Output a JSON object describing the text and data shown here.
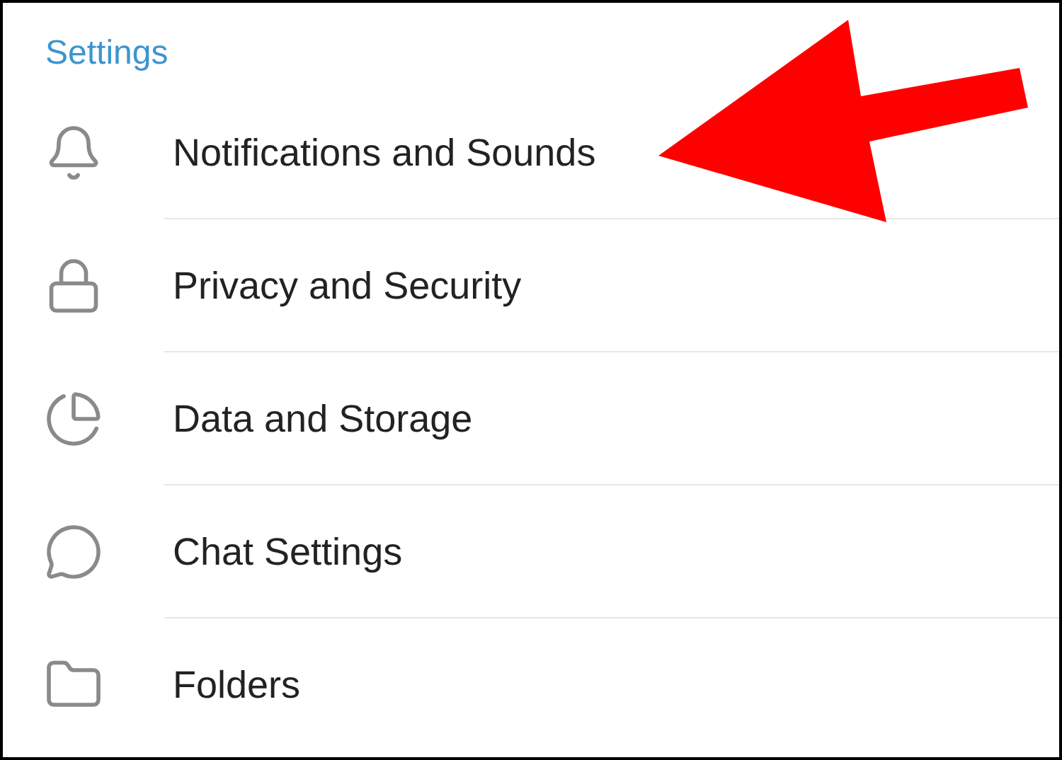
{
  "section_title": "Settings",
  "items": [
    {
      "label": "Notifications and Sounds"
    },
    {
      "label": "Privacy and Security"
    },
    {
      "label": "Data and Storage"
    },
    {
      "label": "Chat Settings"
    },
    {
      "label": "Folders"
    }
  ]
}
